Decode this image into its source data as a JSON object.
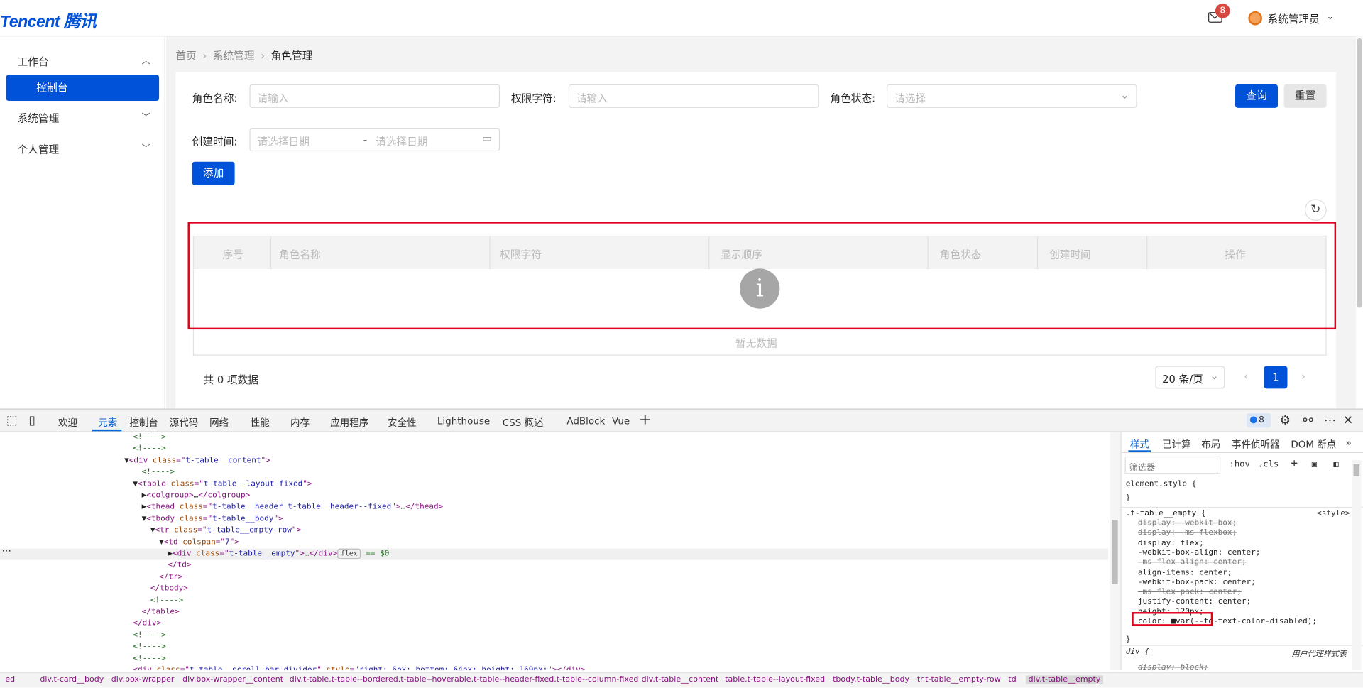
{
  "header": {
    "logo": "Tencent 腾讯",
    "notification_count": "8",
    "user_name": "系统管理员"
  },
  "sidebar": {
    "items": [
      {
        "label": "工作台",
        "expanded": true
      },
      {
        "label": "控制台",
        "active": true
      },
      {
        "label": "系统管理"
      },
      {
        "label": "个人管理"
      }
    ]
  },
  "breadcrumb": [
    "首页",
    "系统管理",
    "角色管理"
  ],
  "filters": {
    "role_name_label": "角色名称:",
    "role_name_placeholder": "请输入",
    "perm_label": "权限字符:",
    "perm_placeholder": "请输入",
    "status_label": "角色状态:",
    "status_placeholder": "请选择",
    "created_label": "创建时间:",
    "date_start_placeholder": "请选择日期",
    "date_sep": "-",
    "date_end_placeholder": "请选择日期",
    "query_button": "查询",
    "reset_button": "重置"
  },
  "actions": {
    "add_button": "添加"
  },
  "table": {
    "columns": [
      "序号",
      "角色名称",
      "权限字符",
      "显示顺序",
      "角色状态",
      "创建时间",
      "操作"
    ],
    "empty_text": "暂无数据"
  },
  "pagination": {
    "total_text": "共 0 项数据",
    "page_size": "20 条/页",
    "current_page": "1"
  },
  "devtools": {
    "tabs": [
      "欢迎",
      "元素",
      "控制台",
      "源代码",
      "网络",
      "性能",
      "内存",
      "应用程序",
      "安全性",
      "Lighthouse",
      "CSS 概述",
      "AdBlock",
      "Vue"
    ],
    "active_tab": "元素",
    "issues_count": "8",
    "dom_lines": [
      {
        "indent": 153,
        "parts": [
          [
            "c-cm",
            "<!---->"
          ]
        ]
      },
      {
        "indent": 153,
        "parts": [
          [
            "c-cm",
            "<!---->"
          ]
        ]
      },
      {
        "indent": 143,
        "parts": [
          [
            "c-tx",
            "▼"
          ],
          [
            "c-tag",
            "<div "
          ],
          [
            "c-an",
            "class"
          ],
          [
            "c-tag",
            "=\""
          ],
          [
            "c-av",
            "t-table__content"
          ],
          [
            "c-tag",
            "\">"
          ]
        ]
      },
      {
        "indent": 163,
        "parts": [
          [
            "c-cm",
            "<!---->"
          ]
        ]
      },
      {
        "indent": 153,
        "parts": [
          [
            "c-tx",
            "▼"
          ],
          [
            "c-tag",
            "<table "
          ],
          [
            "c-an",
            "class"
          ],
          [
            "c-tag",
            "=\""
          ],
          [
            "c-av",
            "t-table--layout-fixed"
          ],
          [
            "c-tag",
            "\">"
          ]
        ]
      },
      {
        "indent": 163,
        "parts": [
          [
            "c-tx",
            "▶"
          ],
          [
            "c-tag",
            "<colgroup>"
          ],
          [
            "c-tx",
            "…"
          ],
          [
            "c-tag",
            "</colgroup>"
          ]
        ]
      },
      {
        "indent": 163,
        "parts": [
          [
            "c-tx",
            "▶"
          ],
          [
            "c-tag",
            "<thead "
          ],
          [
            "c-an",
            "class"
          ],
          [
            "c-tag",
            "=\""
          ],
          [
            "c-av",
            "t-table__header t-table__header--fixed"
          ],
          [
            "c-tag",
            "\">"
          ],
          [
            "c-tx",
            "…"
          ],
          [
            "c-tag",
            "</thead>"
          ]
        ]
      },
      {
        "indent": 163,
        "parts": [
          [
            "c-tx",
            "▼"
          ],
          [
            "c-tag",
            "<tbody "
          ],
          [
            "c-an",
            "class"
          ],
          [
            "c-tag",
            "=\""
          ],
          [
            "c-av",
            "t-table__body"
          ],
          [
            "c-tag",
            "\">"
          ]
        ]
      },
      {
        "indent": 173,
        "parts": [
          [
            "c-tx",
            "▼"
          ],
          [
            "c-tag",
            "<tr "
          ],
          [
            "c-an",
            "class"
          ],
          [
            "c-tag",
            "=\""
          ],
          [
            "c-av",
            "t-table__empty-row"
          ],
          [
            "c-tag",
            "\">"
          ]
        ]
      },
      {
        "indent": 183,
        "parts": [
          [
            "c-tx",
            "▼"
          ],
          [
            "c-tag",
            "<td "
          ],
          [
            "c-an",
            "colspan"
          ],
          [
            "c-tag",
            "=\""
          ],
          [
            "c-av",
            "7"
          ],
          [
            "c-tag",
            "\">"
          ]
        ]
      },
      {
        "indent": 193,
        "sel": true,
        "parts": [
          [
            "c-tx",
            "▶"
          ],
          [
            "c-tag",
            "<div "
          ],
          [
            "c-an",
            "class"
          ],
          [
            "c-tag",
            "=\""
          ],
          [
            "c-av",
            "t-table__empty"
          ],
          [
            "c-tag",
            "\">"
          ],
          [
            "c-tx",
            "…"
          ],
          [
            "c-tag",
            "</div>"
          ],
          [
            "flex",
            "flex"
          ],
          [
            "c-cm",
            " == $0"
          ]
        ]
      },
      {
        "indent": 193,
        "parts": [
          [
            "c-tag",
            "</td>"
          ]
        ]
      },
      {
        "indent": 183,
        "parts": [
          [
            "c-tag",
            "</tr>"
          ]
        ]
      },
      {
        "indent": 173,
        "parts": [
          [
            "c-tag",
            "</tbody>"
          ]
        ]
      },
      {
        "indent": 173,
        "parts": [
          [
            "c-cm",
            "<!---->"
          ]
        ]
      },
      {
        "indent": 163,
        "parts": [
          [
            "c-tag",
            "</table>"
          ]
        ]
      },
      {
        "indent": 153,
        "parts": [
          [
            "c-tag",
            "</div>"
          ]
        ]
      },
      {
        "indent": 153,
        "parts": [
          [
            "c-cm",
            "<!---->"
          ]
        ]
      },
      {
        "indent": 153,
        "parts": [
          [
            "c-cm",
            "<!---->"
          ]
        ]
      },
      {
        "indent": 153,
        "parts": [
          [
            "c-cm",
            "<!---->"
          ]
        ]
      },
      {
        "indent": 153,
        "parts": [
          [
            "c-tag",
            "<div "
          ],
          [
            "c-an",
            "class"
          ],
          [
            "c-tag",
            "=\""
          ],
          [
            "c-av",
            "t-table__scroll-bar-divider"
          ],
          [
            "c-tag",
            "\" "
          ],
          [
            "c-an",
            "style"
          ],
          [
            "c-tag",
            "=\""
          ],
          [
            "c-av",
            "right: 6px; bottom: 64px; height: 169px;"
          ],
          [
            "c-tag",
            "\"></div>"
          ]
        ]
      }
    ],
    "styles_tabs": [
      "样式",
      "已计算",
      "布局",
      "事件侦听器",
      "DOM 断点"
    ],
    "filter_placeholder": "筛选器",
    "hov": ":hov",
    "cls": ".cls",
    "element_style": "element.style {",
    "close_brace": "}",
    "rule_selector": ".t-table__empty {",
    "rule_source": "<style>",
    "declarations": [
      {
        "text": "display: -webkit-box;",
        "strike": true
      },
      {
        "text": "display: -ms-flexbox;",
        "strike": true
      },
      {
        "text": "display: flex;",
        "strike": false
      },
      {
        "text": "-webkit-box-align: center;",
        "strike": false
      },
      {
        "text": "-ms-flex-align: center;",
        "strike": true
      },
      {
        "text": "align-items: center;",
        "strike": false
      },
      {
        "text": "-webkit-box-pack: center;",
        "strike": false
      },
      {
        "text": "-ms-flex-pack: center;",
        "strike": true
      },
      {
        "text": "justify-content: center;",
        "strike": false
      },
      {
        "text": "height: 120px;",
        "strike": false
      },
      {
        "text": "color: ■var(--td-text-color-disabled);",
        "strike": false
      }
    ],
    "ua_selector": "div {",
    "ua_source": "用户代理样式表",
    "ua_decl": "display: block;",
    "breadcrumbs": [
      "ed",
      "div.t-card__body",
      "div.box-wrapper",
      "div.box-wrapper__content",
      "div.t-table.t-table--bordered.t-table--hoverable.t-table--header-fixed.t-table--column-fixed",
      "div.t-table__content",
      "table.t-table--layout-fixed",
      "tbody.t-table__body",
      "tr.t-table__empty-row",
      "td",
      "div.t-table__empty"
    ]
  }
}
